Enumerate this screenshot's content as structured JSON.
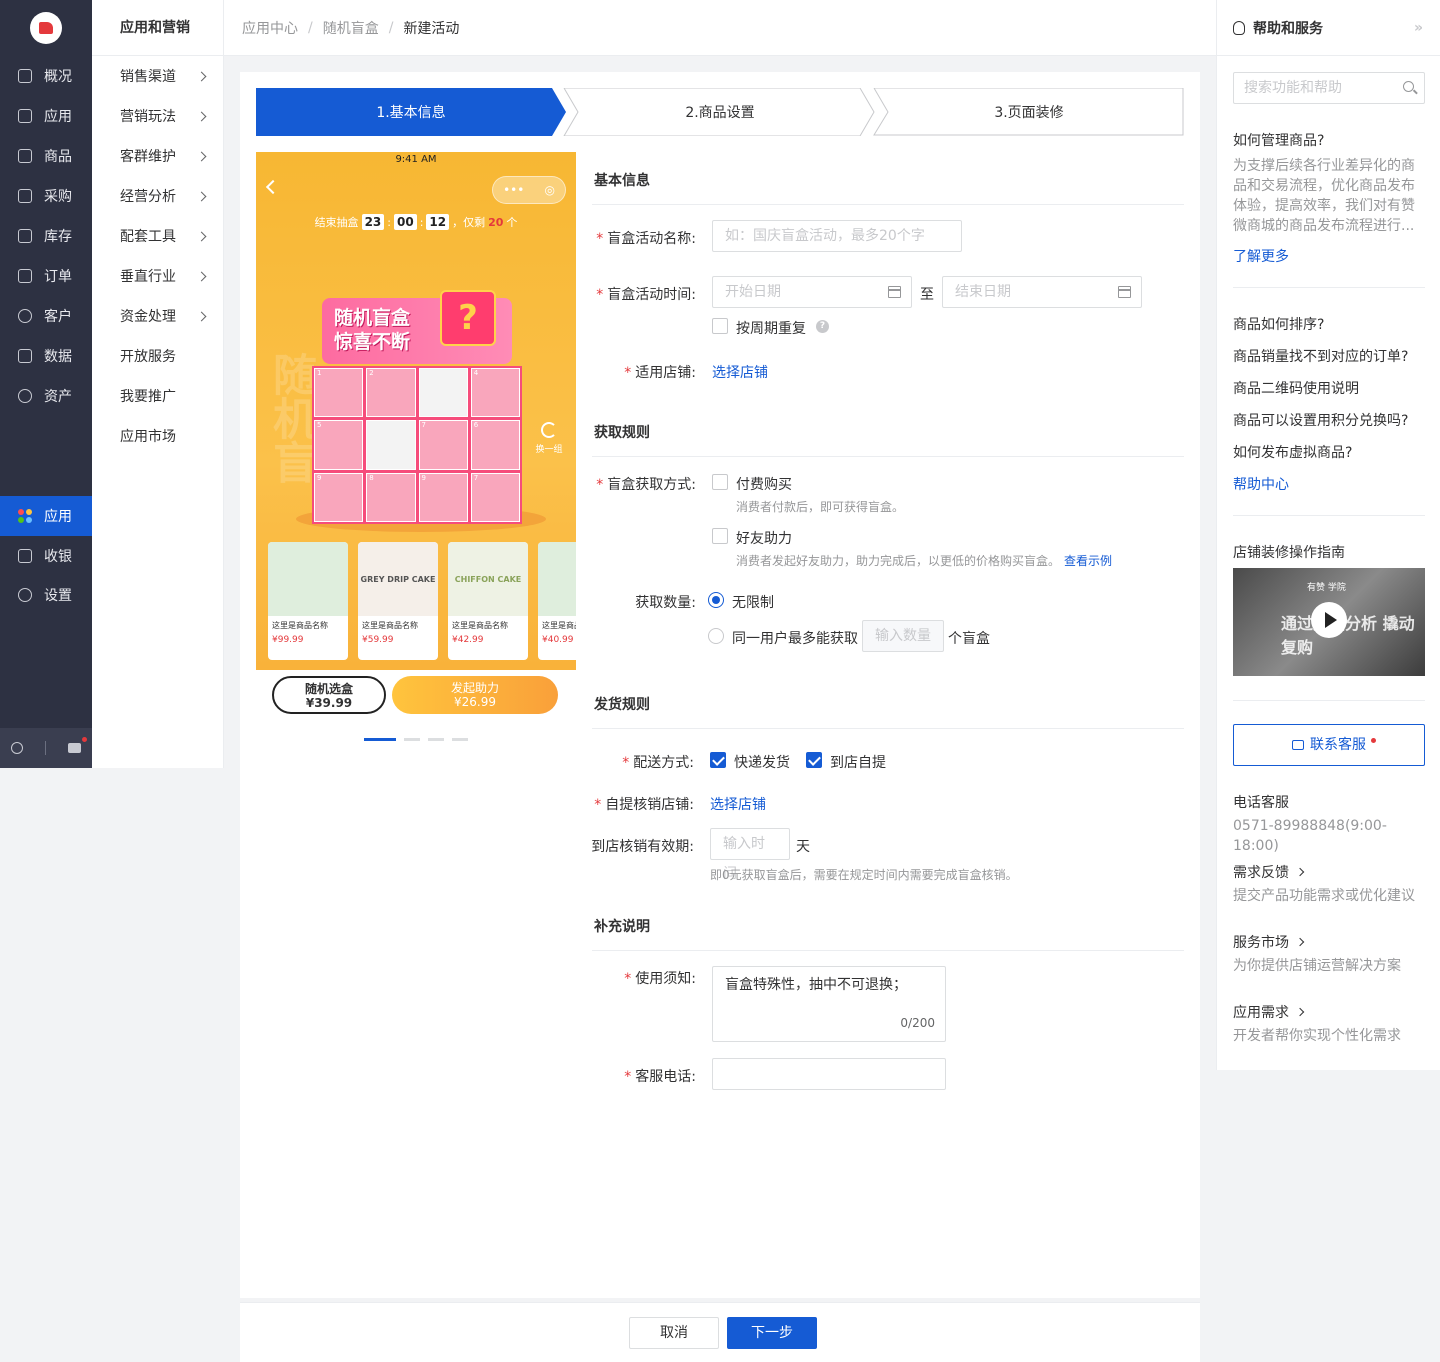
{
  "nav1": {
    "items": [
      "概况",
      "应用",
      "商品",
      "采购",
      "库存",
      "订单",
      "客户",
      "数据",
      "资产"
    ],
    "active": "应用",
    "bottom_items": [
      "收银",
      "设置"
    ]
  },
  "nav2": {
    "title": "应用和营销",
    "items": [
      "销售渠道",
      "营销玩法",
      "客群维护",
      "经营分析",
      "配套工具",
      "垂直行业",
      "资金处理",
      "开放服务",
      "我要推广",
      "应用市场"
    ]
  },
  "breadcrumb": {
    "items": [
      "应用中心",
      "随机盲盒",
      "新建活动"
    ],
    "separator": "/"
  },
  "steps": [
    "1.基本信息",
    "2.商品设置",
    "3.页面装修"
  ],
  "phone": {
    "time": "9:41 AM",
    "countdown_prefix": "结束抽盒",
    "hh": "23",
    "mm": "00",
    "ss": "12",
    "remain_prefix": "，仅剩",
    "remain_count": "20",
    "remain_unit": "个",
    "title_line1": "随机盲盒",
    "title_line2": "惊喜不断",
    "gift_mark": "?",
    "swap_label": "换一组",
    "products": [
      {
        "img_text": "",
        "name": "这里是商品名称",
        "price": "¥99.99"
      },
      {
        "img_text": "GREY DRIP CAKE",
        "name": "这里是商品名称",
        "price": "¥59.99"
      },
      {
        "img_text": "CHIFFON CAKE",
        "name": "这里是商品名称",
        "price": "¥42.99"
      },
      {
        "img_text": "",
        "name": "这里是商品名称",
        "price": "¥40.99"
      }
    ],
    "btn1_label": "随机选盒",
    "btn1_price": "¥39.99",
    "btn2_label": "发起助力",
    "btn2_price": "¥26.99"
  },
  "form": {
    "basic_title": "基本信息",
    "name_label": "盲盒活动名称:",
    "name_placeholder": "如：国庆盲盒活动，最多20个字",
    "time_label": "盲盒活动时间:",
    "start_placeholder": "开始日期",
    "to_text": "至",
    "end_placeholder": "结束日期",
    "repeat_label": "按周期重复",
    "shop_label": "适用店铺:",
    "shop_link": "选择店铺",
    "rule_title": "获取规则",
    "method_label": "盲盒获取方式:",
    "pay_label": "付费购买",
    "pay_hint": "消费者付款后，即可获得盲盒。",
    "friend_label": "好友助力",
    "friend_hint": "消费者发起好友助力，助力完成后，以更低的价格购买盲盒。",
    "friend_example": "查看示例",
    "qty_label": "获取数量:",
    "unlimited_label": "无限制",
    "limit_label": "同一用户最多能获取",
    "limit_placeholder": "输入数量",
    "limit_unit": "个盲盒",
    "ship_title": "发货规则",
    "delivery_label": "配送方式:",
    "express_label": "快递发货",
    "pickup_label": "到店自提",
    "pickup_shop_label": "自提核销店铺:",
    "pickup_shop_link": "选择店铺",
    "valid_label": "到店核销有效期:",
    "valid_placeholder": "输入时间",
    "valid_unit": "天",
    "valid_hint": "即0元获取盲盒后，需要在规定时间内需要完成盲盒核销。",
    "extra_title": "补充说明",
    "notice_label": "使用须知:",
    "notice_value": "盲盒特殊性，抽中不可退换；",
    "notice_count": "0/200",
    "phone_label": "客服电话:"
  },
  "footer": {
    "cancel": "取消",
    "next": "下一步"
  },
  "help": {
    "title": "帮助和服务",
    "search_placeholder": "搜索功能和帮助",
    "q1": "如何管理商品?",
    "q1_desc": "为支撑后续各行业差异化的商品和交易流程，优化商品发布体验，提高效率，我们对有赞微商城的商品发布流程进行...",
    "learn_more": "了解更多",
    "faqs": [
      "商品如何排序?",
      "商品销量找不到对应的订单?",
      "商品二维码使用说明",
      "商品可以设置用积分兑换吗?",
      "如何发布虚拟商品?"
    ],
    "help_center": "帮助中心",
    "guide_title": "店铺装修操作指南",
    "video_brand": "有赞 学院",
    "video_text": "通过数据分析 撬动复购",
    "contact": "联系客服",
    "phone_title": "电话客服",
    "phone_number": "0571-89988848(9:00-18:00)",
    "feedback_title": "需求反馈",
    "feedback_desc": "提交产品功能需求或优化建议",
    "market_title": "服务市场",
    "market_desc": "为你提供店铺运营解决方案",
    "app_title": "应用需求",
    "app_desc": "开发者帮你实现个性化需求"
  },
  "colors": {
    "primary": "#155bd4",
    "danger": "#e4393c",
    "sidebar": "#2d3142"
  }
}
